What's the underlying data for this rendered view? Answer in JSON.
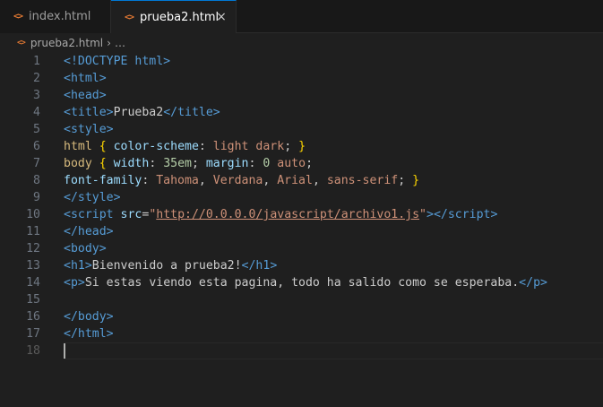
{
  "tabs": [
    {
      "label": "index.html",
      "icon": "html-file-icon",
      "active": false
    },
    {
      "label": "prueba2.html",
      "icon": "html-file-icon",
      "active": true,
      "close": "×"
    }
  ],
  "breadcrumb": {
    "file": "prueba2.html",
    "more": "…",
    "sep": "›"
  },
  "icon_glyph": "<>",
  "lines": [
    {
      "n": "1",
      "tokens": [
        [
          "tg",
          "<!DOCTYPE "
        ],
        [
          "tg",
          "html"
        ],
        [
          "tg",
          ">"
        ]
      ]
    },
    {
      "n": "2",
      "tokens": [
        [
          "br",
          "<"
        ],
        [
          "tg",
          "html"
        ],
        [
          "br",
          ">"
        ]
      ]
    },
    {
      "n": "3",
      "tokens": [
        [
          "br",
          "<"
        ],
        [
          "tg",
          "head"
        ],
        [
          "br",
          ">"
        ]
      ]
    },
    {
      "n": "4",
      "tokens": [
        [
          "br",
          "<"
        ],
        [
          "tg",
          "title"
        ],
        [
          "br",
          ">"
        ],
        [
          "tx",
          "Prueba2"
        ],
        [
          "br",
          "</"
        ],
        [
          "tg",
          "title"
        ],
        [
          "br",
          ">"
        ]
      ]
    },
    {
      "n": "5",
      "tokens": [
        [
          "br",
          "<"
        ],
        [
          "tg",
          "style"
        ],
        [
          "br",
          ">"
        ]
      ]
    },
    {
      "n": "6",
      "tokens": [
        [
          "yb2",
          "html "
        ],
        [
          "yb",
          "{"
        ],
        [
          "tx",
          " "
        ],
        [
          "at",
          "color-scheme"
        ],
        [
          "tx",
          ": "
        ],
        [
          "st",
          "light dark"
        ],
        [
          "tx",
          "; "
        ],
        [
          "yb",
          "}"
        ]
      ]
    },
    {
      "n": "7",
      "tokens": [
        [
          "yb2",
          "body "
        ],
        [
          "yb",
          "{"
        ],
        [
          "tx",
          " "
        ],
        [
          "at",
          "width"
        ],
        [
          "tx",
          ": "
        ],
        [
          "nu",
          "35em"
        ],
        [
          "tx",
          "; "
        ],
        [
          "at",
          "margin"
        ],
        [
          "tx",
          ": "
        ],
        [
          "nu",
          "0"
        ],
        [
          "tx",
          " "
        ],
        [
          "st",
          "auto"
        ],
        [
          "tx",
          ";"
        ]
      ]
    },
    {
      "n": "8",
      "tokens": [
        [
          "at",
          "font-family"
        ],
        [
          "tx",
          ": "
        ],
        [
          "st",
          "Tahoma"
        ],
        [
          "tx",
          ", "
        ],
        [
          "st",
          "Verdana"
        ],
        [
          "tx",
          ", "
        ],
        [
          "st",
          "Arial"
        ],
        [
          "tx",
          ", "
        ],
        [
          "st",
          "sans-serif"
        ],
        [
          "tx",
          "; "
        ],
        [
          "yb",
          "}"
        ]
      ]
    },
    {
      "n": "9",
      "tokens": [
        [
          "br",
          "</"
        ],
        [
          "tg",
          "style"
        ],
        [
          "br",
          ">"
        ]
      ]
    },
    {
      "n": "10",
      "tokens": [
        [
          "br",
          "<"
        ],
        [
          "tg",
          "script"
        ],
        [
          "tx",
          " "
        ],
        [
          "at",
          "src"
        ],
        [
          "tx",
          "="
        ],
        [
          "st",
          "\""
        ],
        [
          "stl",
          "http://0.0.0.0/javascript/archivo1.js"
        ],
        [
          "st",
          "\""
        ],
        [
          "br",
          "></"
        ],
        [
          "tg",
          "script"
        ],
        [
          "br",
          ">"
        ]
      ]
    },
    {
      "n": "11",
      "tokens": [
        [
          "br",
          "</"
        ],
        [
          "tg",
          "head"
        ],
        [
          "br",
          ">"
        ]
      ]
    },
    {
      "n": "12",
      "tokens": [
        [
          "br",
          "<"
        ],
        [
          "tg",
          "body"
        ],
        [
          "br",
          ">"
        ]
      ]
    },
    {
      "n": "13",
      "tokens": [
        [
          "br",
          "<"
        ],
        [
          "tg",
          "h1"
        ],
        [
          "br",
          ">"
        ],
        [
          "tx",
          "Bienvenido a prueba2!"
        ],
        [
          "br",
          "</"
        ],
        [
          "tg",
          "h1"
        ],
        [
          "br",
          ">"
        ]
      ]
    },
    {
      "n": "14",
      "tokens": [
        [
          "br",
          "<"
        ],
        [
          "tg",
          "p"
        ],
        [
          "br",
          ">"
        ],
        [
          "tx",
          "Si estas viendo esta pagina, todo ha salido como se esperaba."
        ],
        [
          "br",
          "</"
        ],
        [
          "tg",
          "p"
        ],
        [
          "br",
          ">"
        ]
      ]
    },
    {
      "n": "15",
      "tokens": []
    },
    {
      "n": "16",
      "tokens": [
        [
          "br",
          "</"
        ],
        [
          "tg",
          "body"
        ],
        [
          "br",
          ">"
        ]
      ]
    },
    {
      "n": "17",
      "tokens": [
        [
          "br",
          "</"
        ],
        [
          "tg",
          "html"
        ],
        [
          "br",
          ">"
        ]
      ]
    },
    {
      "n": "18",
      "tokens": [],
      "current": true
    }
  ],
  "colors": {
    "accent": "#0078d4",
    "icon": "#e37933",
    "tag": "#569cd6",
    "string": "#ce9178",
    "attr": "#9cdcfe",
    "number": "#b5cea8",
    "brace": "#ffd700",
    "selector": "#d7ba7d"
  }
}
